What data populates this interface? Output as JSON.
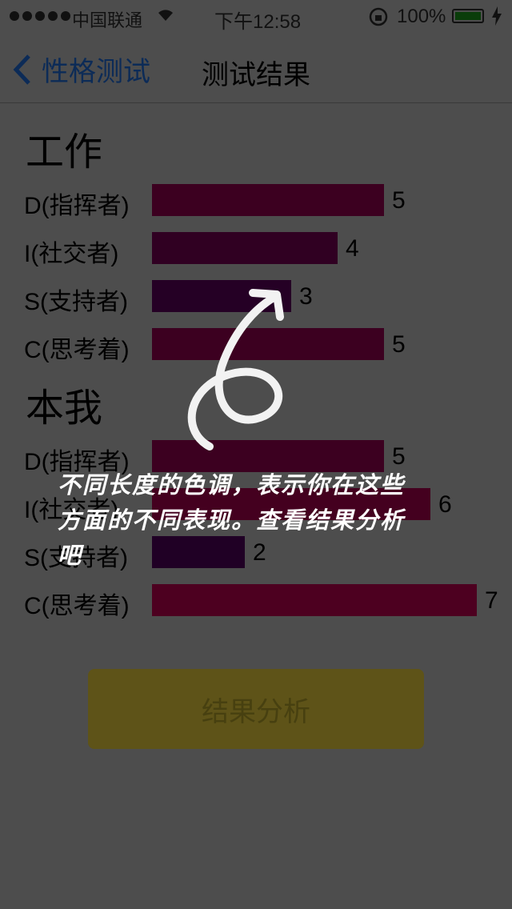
{
  "status_bar": {
    "carrier": "中国联通",
    "time": "下午12:58",
    "battery_pct": "100%"
  },
  "nav": {
    "back_label": "性格测试",
    "title": "测试结果"
  },
  "sections": [
    {
      "title": "工作",
      "rows": [
        {
          "label": "D(指挥者)",
          "value": 5,
          "value_text": "5",
          "color": "#3c0020"
        },
        {
          "label": "I(社交者)",
          "value": 4,
          "value_text": "4",
          "color": "#300022"
        },
        {
          "label": "S(支持者)",
          "value": 3,
          "value_text": "3",
          "color": "#250025"
        },
        {
          "label": "C(思考着)",
          "value": 5,
          "value_text": "5",
          "color": "#3c0020"
        }
      ]
    },
    {
      "title": "本我",
      "rows": [
        {
          "label": "D(指挥者)",
          "value": 5,
          "value_text": "5",
          "color": "#3c0020"
        },
        {
          "label": "I(社交者)",
          "value": 6,
          "value_text": "6",
          "color": "#44001f"
        },
        {
          "label": "S(支持者)",
          "value": 2,
          "value_text": "2",
          "color": "#200025"
        },
        {
          "label": "C(思考着)",
          "value": 7,
          "value_text": "7",
          "color": "#4d0020"
        }
      ]
    }
  ],
  "button": {
    "label": "结果分析"
  },
  "hint": {
    "text": "不同长度的色调，表示你在这些方面的不同表现。查看结果分析吧"
  }
}
